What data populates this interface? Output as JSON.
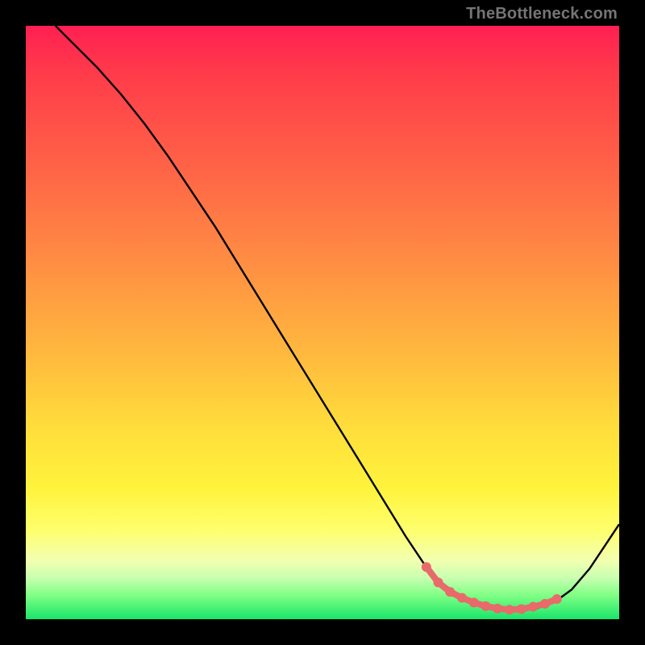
{
  "watermark": "TheBottleneck.com",
  "colors": {
    "curve": "#000000",
    "marker_fill": "#e86a6a",
    "marker_stroke": "#e86a6a"
  },
  "chart_data": {
    "type": "line",
    "title": "",
    "xlabel": "",
    "ylabel": "",
    "xlim": [
      0,
      100
    ],
    "ylim": [
      0,
      100
    ],
    "series": [
      {
        "name": "bottleneck-curve",
        "x": [
          5,
          8,
          12,
          16,
          20,
          24,
          28,
          32,
          36,
          40,
          44,
          48,
          52,
          56,
          60,
          64,
          67,
          70,
          73,
          76,
          79.5,
          83,
          86,
          89,
          92,
          95,
          98,
          100
        ],
        "values": [
          100,
          97,
          93,
          88.5,
          83.5,
          78,
          72,
          66,
          59.5,
          53,
          46.5,
          40,
          33.5,
          27,
          20.5,
          14,
          9.5,
          6.2,
          4.0,
          2.6,
          1.8,
          1.6,
          1.8,
          2.8,
          5.0,
          8.5,
          13,
          16
        ]
      }
    ],
    "markers": {
      "name": "highlight-range",
      "x": [
        67.5,
        69.5,
        71.5,
        73.5,
        75.5,
        77.5,
        79.5,
        81.5,
        83.5,
        85.5,
        87.5,
        89.5
      ],
      "values": [
        8.8,
        6.2,
        4.6,
        3.6,
        2.8,
        2.2,
        1.8,
        1.6,
        1.7,
        2.1,
        2.6,
        3.4
      ]
    }
  }
}
